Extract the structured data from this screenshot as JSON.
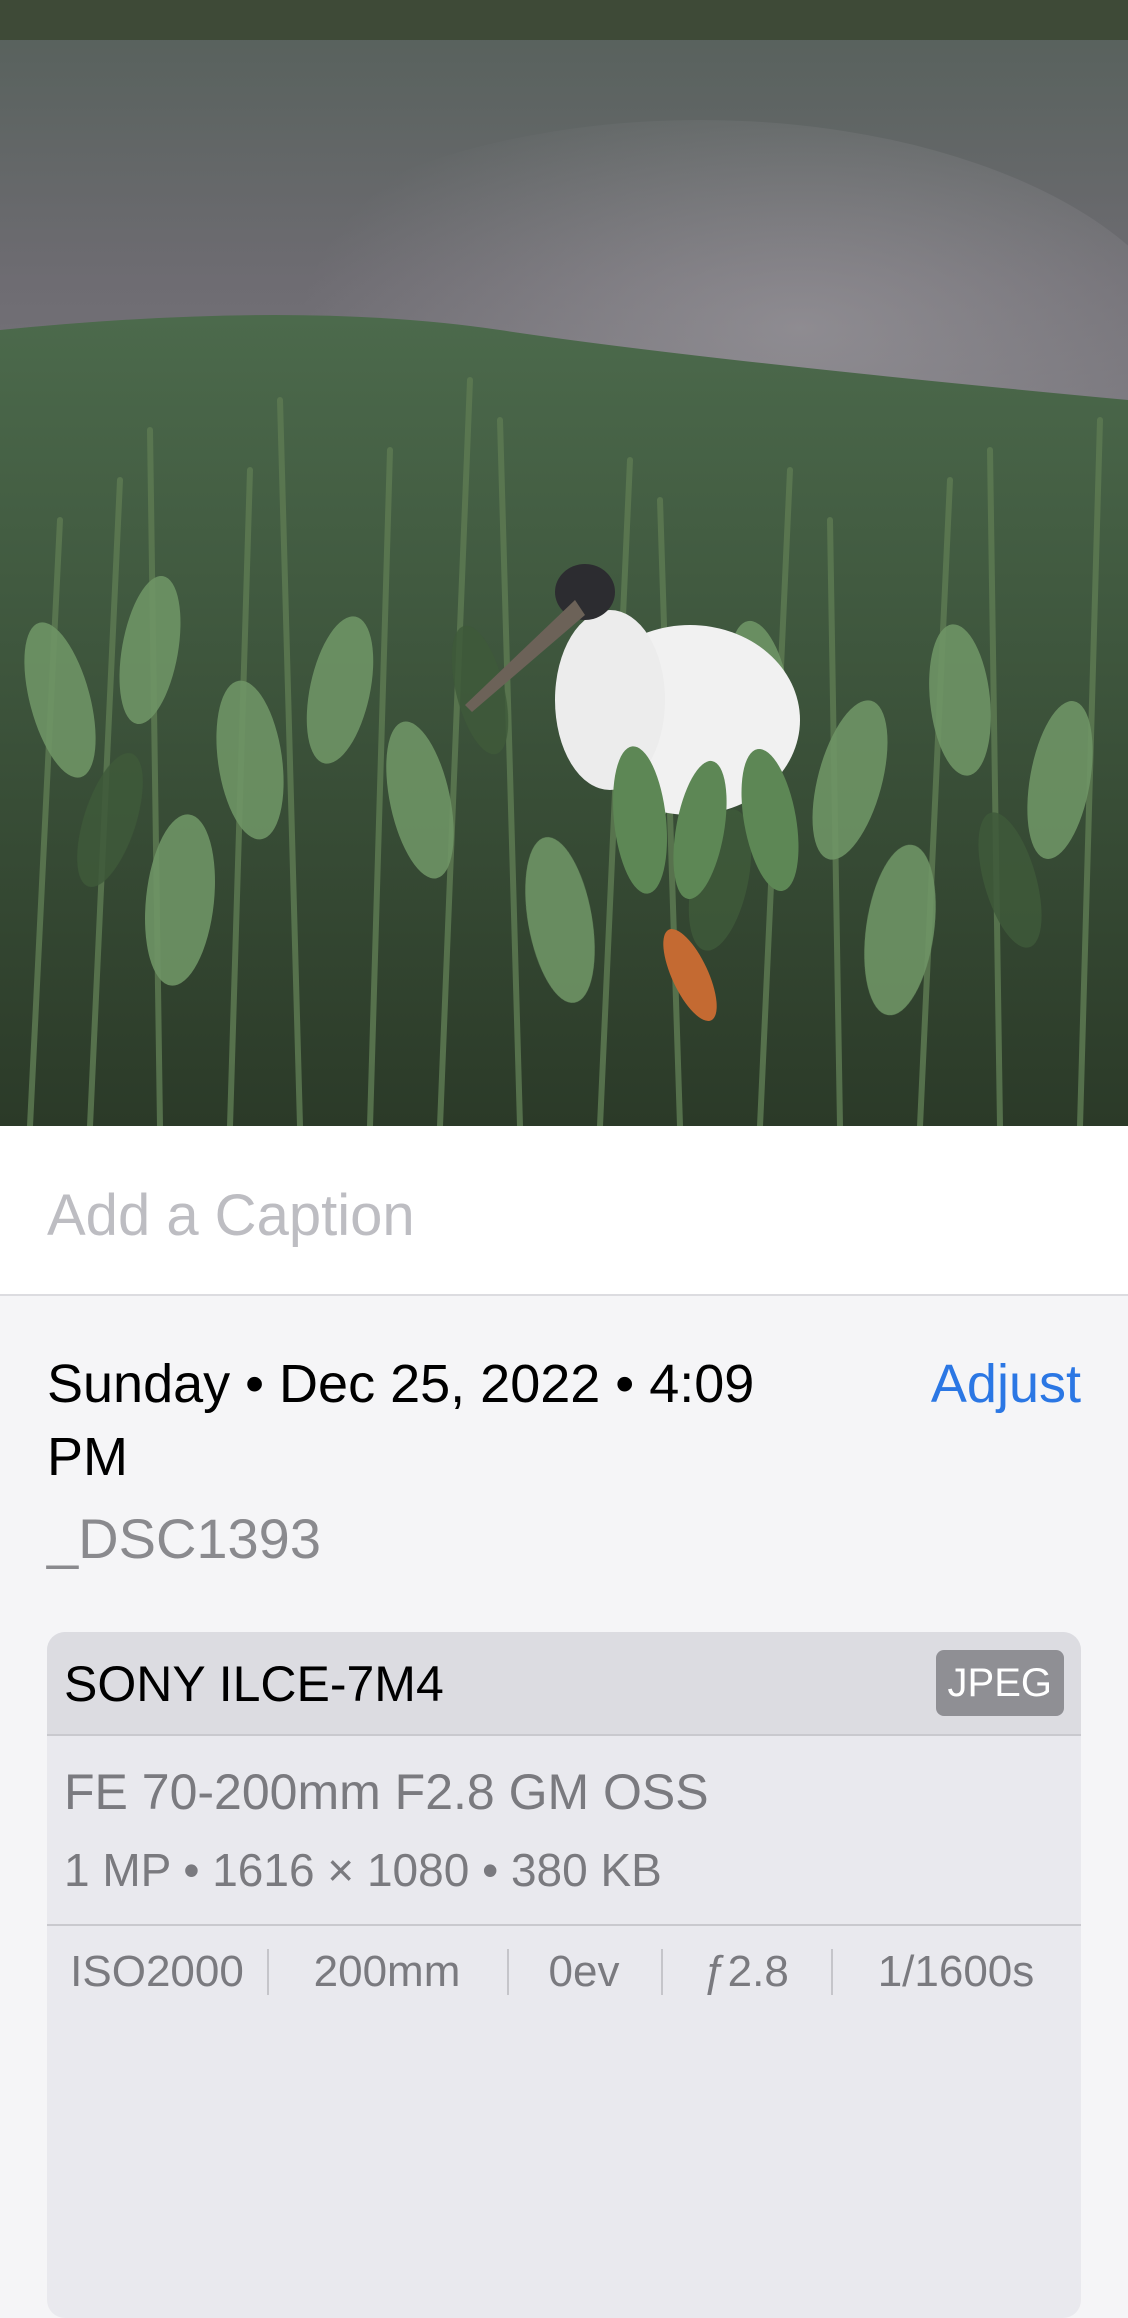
{
  "caption": {
    "placeholder": "Add a Caption"
  },
  "info": {
    "datetime": "Sunday • Dec 25, 2022 • 4:09 PM",
    "adjust_label": "Adjust",
    "filename": "_DSC1393"
  },
  "camera": {
    "model": "SONY ILCE-7M4",
    "format": "JPEG",
    "lens": "FE 70-200mm F2.8 GM OSS",
    "specs": "1 MP • 1616 × 1080 • 380 KB",
    "exif": {
      "iso": "ISO2000",
      "focal_length": "200mm",
      "exposure_bias": "0ev",
      "aperture": "ƒ2.8",
      "shutter": "1/1600s"
    }
  },
  "colors": {
    "accent": "#2b77e4",
    "badge": "#8f8f94"
  }
}
